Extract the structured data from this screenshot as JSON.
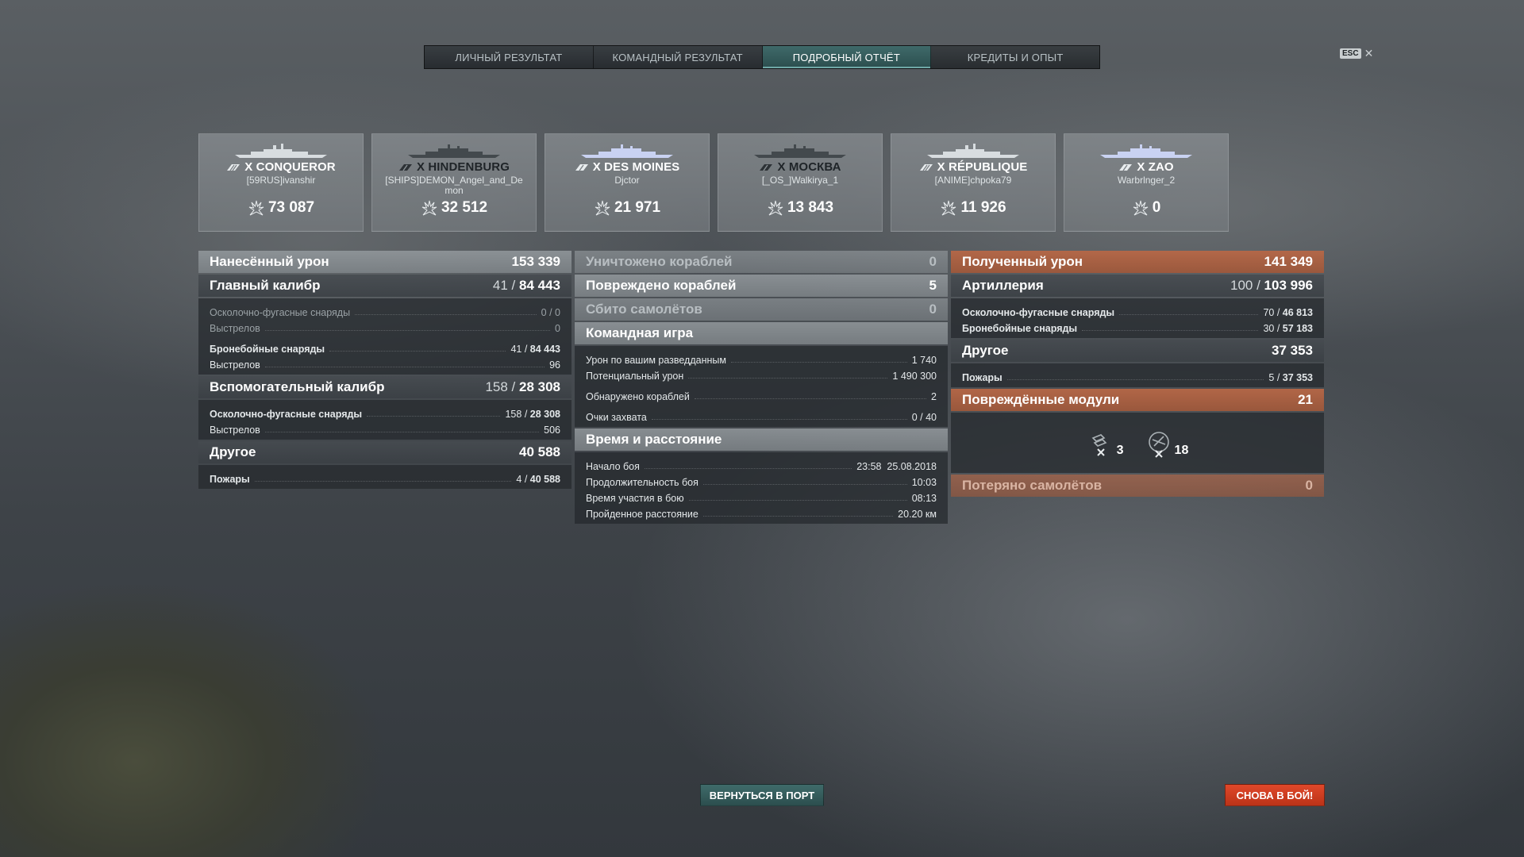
{
  "tabs": [
    {
      "label": "ЛИЧНЫЙ РЕЗУЛЬТАТ",
      "active": false
    },
    {
      "label": "КОМАНДНЫЙ РЕЗУЛЬТАТ",
      "active": false
    },
    {
      "label": "ПОДРОБНЫЙ ОТЧЁТ",
      "active": true
    },
    {
      "label": "КРЕДИТЫ И ОПЫТ",
      "active": false
    }
  ],
  "close": {
    "key_label": "ESC",
    "icon": "close-icon"
  },
  "ships": [
    {
      "name": "X CONQUEROR",
      "player": "[59RUS]ivanshir",
      "damage": "73 087",
      "icon": "battleship-icon"
    },
    {
      "name": "X HINDENBURG",
      "player": "[SHIPS]DEMON_Angel_and_Demon",
      "damage": "32 512",
      "icon": "cruiser-icon"
    },
    {
      "name": "X DES MOINES",
      "player": "Djctor",
      "damage": "21 971",
      "icon": "cruiser-icon"
    },
    {
      "name": "X МОСКВА",
      "player": "[_OS_]Walkirya_1",
      "damage": "13 843",
      "icon": "cruiser-icon"
    },
    {
      "name": "X RÉPUBLIQUE",
      "player": "[ANIME]chpoka79",
      "damage": "11 926",
      "icon": "battleship-icon"
    },
    {
      "name": "X ZAO",
      "player": "Warbrlnger_2",
      "damage": "0",
      "icon": "cruiser-icon"
    }
  ],
  "dealt": {
    "title": "Нанесённый урон",
    "total": "153 339",
    "main": {
      "title": "Главный калибр",
      "hits": "41",
      "dmg": "84 443",
      "he_label": "Осколочно-фугасные снаряды",
      "he_value": "0 / 0",
      "he_shots_label": "Выстрелов",
      "he_shots": "0",
      "ap_label": "Бронебойные снаряды",
      "ap_hits": "41",
      "ap_dmg": "84 443",
      "ap_shots_label": "Выстрелов",
      "ap_shots": "96"
    },
    "secondary": {
      "title": "Вспомогательный калибр",
      "hits": "158",
      "dmg": "28 308",
      "he_label": "Осколочно-фугасные снаряды",
      "he_hits": "158",
      "he_dmg": "28 308",
      "shots_label": "Выстрелов",
      "shots": "506"
    },
    "other": {
      "title": "Другое",
      "total": "40 588",
      "fires_label": "Пожары",
      "fires_count": "4",
      "fires_dmg": "40 588"
    }
  },
  "middle": {
    "destroyed_label": "Уничтожено кораблей",
    "destroyed": "0",
    "damaged_label": "Повреждено кораблей",
    "damaged": "5",
    "planes_label": "Сбито самолётов",
    "planes": "0",
    "team": {
      "title": "Командная игра",
      "spotting_label": "Урон по вашим разведданным",
      "spotting": "1 740",
      "potential_label": "Потенциальный урон",
      "potential": "1 490 300",
      "spotted_label": "Обнаружено кораблей",
      "spotted": "2",
      "capture_label": "Очки захвата",
      "capture": "0 / 40"
    },
    "time": {
      "title": "Время и расстояние",
      "start_label": "Начало боя",
      "start": "23:58  25.08.2018",
      "duration_label": "Продолжительность боя",
      "duration": "10:03",
      "participation_label": "Время участия в бою",
      "participation": "08:13",
      "distance_label": "Пройденное расстояние",
      "distance": "20.20 км"
    }
  },
  "received": {
    "title": "Полученный урон",
    "total": "141 349",
    "artillery": {
      "title": "Артиллерия",
      "hits": "100",
      "dmg": "103 996",
      "he_label": "Осколочно-фугасные снаряды",
      "he_hits": "70",
      "he_dmg": "46 813",
      "ap_label": "Бронебойные снаряды",
      "ap_hits": "30",
      "ap_dmg": "57 183"
    },
    "other": {
      "title": "Другое",
      "total": "37 353",
      "fires_label": "Пожары",
      "fires_count": "5",
      "fires_dmg": "37 353"
    },
    "modules": {
      "title": "Повреждённые модули",
      "total": "21",
      "items": [
        {
          "icon": "gun-module-icon",
          "count": "3"
        },
        {
          "icon": "aa-module-icon",
          "count": "18"
        }
      ]
    },
    "planes_lost_label": "Потеряно самолётов",
    "planes_lost": "0"
  },
  "buttons": {
    "port": "ВЕРНУТЬСЯ В ПОРТ",
    "battle": "СНОВА В БОЙ!"
  },
  "colors": {
    "accent_teal": "#3f6b6a",
    "battle_red": "#e0482a",
    "received_orange": "#ba6846"
  }
}
